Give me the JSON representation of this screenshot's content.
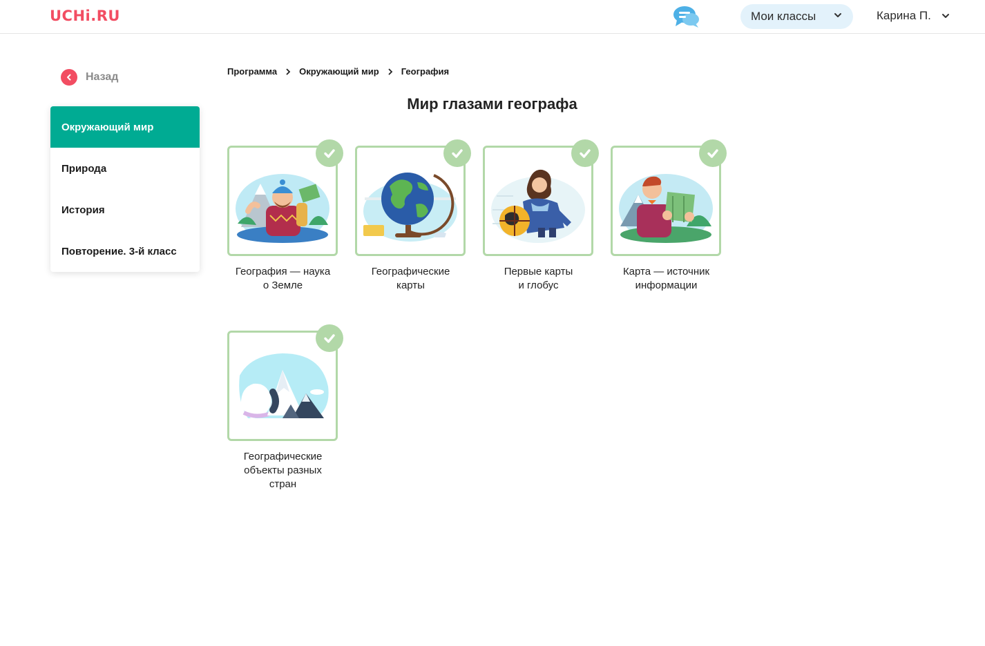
{
  "header": {
    "logo": "UCHi.RU",
    "classes_label": "Мои классы",
    "user_label": "Карина П."
  },
  "back_label": "Назад",
  "sidebar": {
    "items": [
      {
        "label": "Окружающий мир",
        "active": true
      },
      {
        "label": "Природа",
        "active": false
      },
      {
        "label": "История",
        "active": false
      },
      {
        "label": "Повторение. 3-й класс",
        "active": false
      }
    ]
  },
  "breadcrumb": [
    "Программа",
    "Окружающий мир",
    "География"
  ],
  "title": "Мир глазами географа",
  "lessons": [
    {
      "line1": "География — наука",
      "line2": "о Земле",
      "line3": "",
      "completed": true,
      "icon": "hiker-illustration"
    },
    {
      "line1": "Географические",
      "line2": "карты",
      "line3": "",
      "completed": true,
      "icon": "globe-illustration"
    },
    {
      "line1": "Первые карты",
      "line2": "и глобус",
      "line3": "",
      "completed": true,
      "icon": "cartographer-illustration"
    },
    {
      "line1": "Карта — источник",
      "line2": "информации",
      "line3": "",
      "completed": true,
      "icon": "map-reader-illustration"
    },
    {
      "line1": "Географические",
      "line2": "объекты разных",
      "line3": "стран",
      "completed": true,
      "icon": "mountains-illustration"
    }
  ],
  "colors": {
    "brand": "#f24d62",
    "active_menu": "#00ab93",
    "card_border": "#b2d8a8",
    "classes_bg": "#e3f2fb"
  }
}
